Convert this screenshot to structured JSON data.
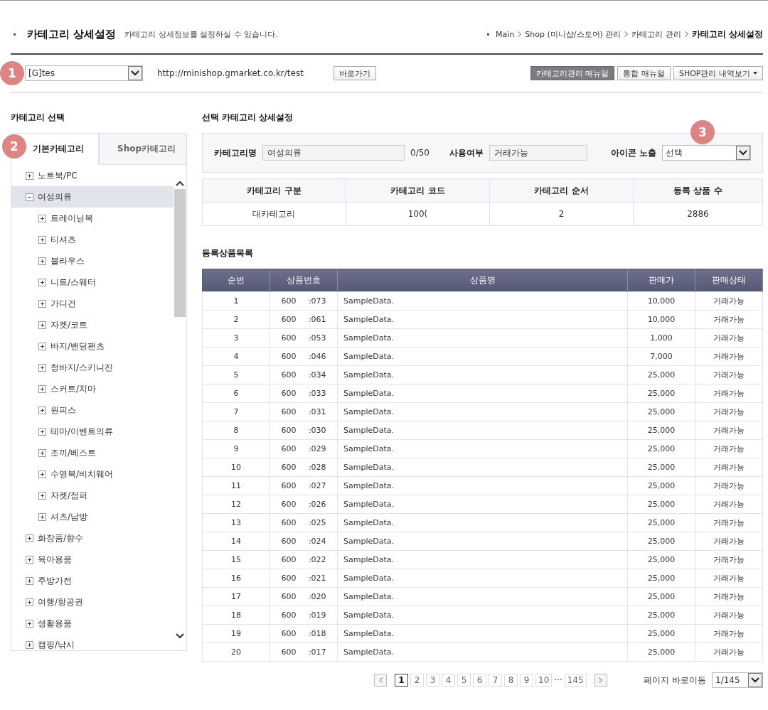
{
  "header": {
    "title": "카테고리 상세설정",
    "description": "카테고리 상세정보를 설정하실 수 있습니다.",
    "breadcrumb": [
      {
        "label": "Main",
        "current": false
      },
      {
        "label": "Shop (미니샵/스토어) 관리",
        "current": false
      },
      {
        "label": "카테고리 관리",
        "current": false
      },
      {
        "label": "카테고리 상세설정",
        "current": true
      }
    ]
  },
  "toolbar": {
    "shop_select": {
      "value": "[G]tes",
      "marker": "1"
    },
    "url": "http://minishop.gmarket.co.kr/test",
    "go_button": "바로가기",
    "buttons": [
      {
        "label": "카테고리관리 매뉴얼",
        "primary": true,
        "dropdown": false
      },
      {
        "label": "통합 매뉴얼",
        "primary": false,
        "dropdown": false
      },
      {
        "label": "SHOP관리 내역보기",
        "primary": false,
        "dropdown": true
      }
    ]
  },
  "sidebar": {
    "title": "카테고리 선택",
    "tabs": [
      {
        "label": "기본카테고리",
        "selected": true,
        "marker": "2"
      },
      {
        "label": "Shop카테고리",
        "selected": false
      }
    ],
    "tree": [
      {
        "label": "노트북/PC",
        "expanded": false,
        "selected": false
      },
      {
        "label": "여성의류",
        "expanded": true,
        "selected": true,
        "children": [
          {
            "label": "트레이닝복",
            "expanded": false,
            "selected": false
          },
          {
            "label": "티셔츠",
            "expanded": false,
            "selected": false
          },
          {
            "label": "블라우스",
            "expanded": false,
            "selected": false
          },
          {
            "label": "니트/스웨터",
            "expanded": false,
            "selected": false
          },
          {
            "label": "가디건",
            "expanded": false,
            "selected": false
          },
          {
            "label": "자켓/코트",
            "expanded": false,
            "selected": false
          },
          {
            "label": "바지/밴딩팬츠",
            "expanded": false,
            "selected": false
          },
          {
            "label": "청바지/스키니진",
            "expanded": false,
            "selected": false
          },
          {
            "label": "스커트/치마",
            "expanded": false,
            "selected": false
          },
          {
            "label": "원피스",
            "expanded": false,
            "selected": false
          },
          {
            "label": "테마/이벤트의류",
            "expanded": false,
            "selected": false
          },
          {
            "label": "조끼/베스트",
            "expanded": false,
            "selected": false
          },
          {
            "label": "수영복/비치웨어",
            "expanded": false,
            "selected": false
          },
          {
            "label": "자켓/점퍼",
            "expanded": false,
            "selected": false
          },
          {
            "label": "셔츠/남방",
            "expanded": false,
            "selected": false
          }
        ]
      },
      {
        "label": "화장품/향수",
        "expanded": false,
        "selected": false
      },
      {
        "label": "육아용품",
        "expanded": false,
        "selected": false
      },
      {
        "label": "주방가전",
        "expanded": false,
        "selected": false
      },
      {
        "label": "여행/항공권",
        "expanded": false,
        "selected": false
      },
      {
        "label": "생활용품",
        "expanded": false,
        "selected": false
      },
      {
        "label": "캠핑/낚시",
        "expanded": false,
        "selected": false
      }
    ]
  },
  "detail": {
    "title": "선택 카테고리 상세설정",
    "name_label": "카테고리명",
    "name_value": "여성의류",
    "name_count": "0/50",
    "usage_label": "사용여부",
    "usage_value": "거래가능",
    "icon_label": "아이콘 노출",
    "icon_value": "선택",
    "icon_marker": "3",
    "info_columns": [
      "카테고리 구분",
      "카테고리 코드",
      "카테고리 순서",
      "등록 상품 수"
    ],
    "info_values": [
      "대카테고리",
      "100(",
      "2",
      "2886"
    ]
  },
  "products": {
    "title": "등록상품목록",
    "columns": [
      "순번",
      "상품번호",
      "상품명",
      "판매가",
      "판매상태"
    ],
    "rows": [
      [
        "1",
        "600 :073",
        "SampleData.",
        "10,000",
        "거래가능"
      ],
      [
        "2",
        "600 :061",
        "SampleData.",
        "10,000",
        "거래가능"
      ],
      [
        "3",
        "600 :053",
        "SampleData.",
        "1,000",
        "거래가능"
      ],
      [
        "4",
        "600 :046",
        "SampleData.",
        "7,000",
        "거래가능"
      ],
      [
        "5",
        "600 :034",
        "SampleData.",
        "25,000",
        "거래가능"
      ],
      [
        "6",
        "600 :033",
        "SampleData.",
        "25,000",
        "거래가능"
      ],
      [
        "7",
        "600 :031",
        "SampleData.",
        "25,000",
        "거래가능"
      ],
      [
        "8",
        "600 :030",
        "SampleData.",
        "25,000",
        "거래가능"
      ],
      [
        "9",
        "600 :029",
        "SampleData.",
        "25,000",
        "거래가능"
      ],
      [
        "10",
        "600 :028",
        "SampleData.",
        "25,000",
        "거래가능"
      ],
      [
        "11",
        "600 :027",
        "SampleData.",
        "25,000",
        "거래가능"
      ],
      [
        "12",
        "600 :026",
        "SampleData.",
        "25,000",
        "거래가능"
      ],
      [
        "13",
        "600 :025",
        "SampleData.",
        "25,000",
        "거래가능"
      ],
      [
        "14",
        "600 :024",
        "SampleData.",
        "25,000",
        "거래가능"
      ],
      [
        "15",
        "600 :022",
        "SampleData.",
        "25,000",
        "거래가능"
      ],
      [
        "16",
        "600 :021",
        "SampleData.",
        "25,000",
        "거래가능"
      ],
      [
        "17",
        "600 :020",
        "SampleData.",
        "25,000",
        "거래가능"
      ],
      [
        "18",
        "600 :019",
        "SampleData.",
        "25,000",
        "거래가능"
      ],
      [
        "19",
        "600 :018",
        "SampleData.",
        "25,000",
        "거래가능"
      ],
      [
        "20",
        "600 :017",
        "SampleData.",
        "25,000",
        "거래가능"
      ]
    ]
  },
  "pagination": {
    "pages": [
      {
        "label": "1",
        "selected": true
      },
      {
        "label": "2",
        "selected": false
      },
      {
        "label": "3",
        "selected": false
      },
      {
        "label": "4",
        "selected": false
      },
      {
        "label": "5",
        "selected": false
      },
      {
        "label": "6",
        "selected": false
      },
      {
        "label": "7",
        "selected": false
      },
      {
        "label": "8",
        "selected": false
      },
      {
        "label": "9",
        "selected": false
      },
      {
        "label": "10",
        "selected": false
      }
    ],
    "ellipsis": "···",
    "last": "145",
    "jump_label": "페이지 바로이동",
    "jump_value": "1/145"
  }
}
